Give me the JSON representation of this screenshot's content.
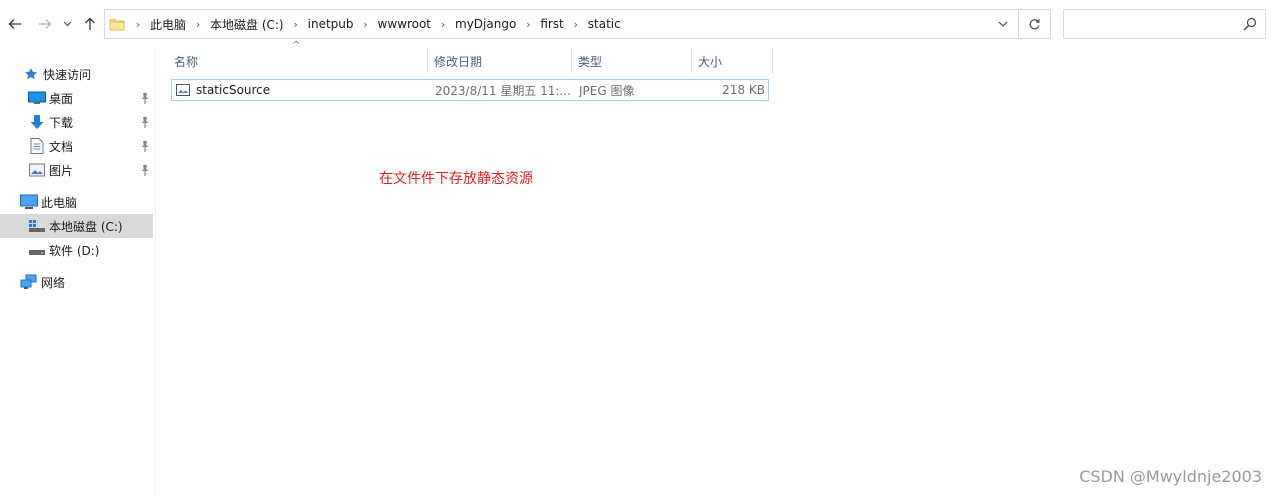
{
  "toolbar": {
    "back_icon": "arrow-left-icon",
    "forward_icon": "arrow-right-icon",
    "recent_icon": "chevron-down-icon",
    "up_icon": "arrow-up-icon"
  },
  "address": {
    "folder_icon": "folder-icon",
    "crumbs": [
      "此电脑",
      "本地磁盘 (C:)",
      "inetpub",
      "wwwroot",
      "myDjango",
      "first",
      "static"
    ],
    "dropdown_icon": "chevron-down-icon",
    "refresh_icon": "refresh-icon"
  },
  "search": {
    "placeholder": "",
    "value": "",
    "icon": "search-icon"
  },
  "navpane": {
    "quick_access": {
      "label": "快速访问",
      "icon": "star-icon"
    },
    "pinned": [
      {
        "label": "桌面",
        "icon": "desktop-icon",
        "pinned": true
      },
      {
        "label": "下载",
        "icon": "download-icon",
        "pinned": true
      },
      {
        "label": "文档",
        "icon": "document-icon",
        "pinned": true
      },
      {
        "label": "图片",
        "icon": "pictures-icon",
        "pinned": true
      }
    ],
    "this_pc": {
      "label": "此电脑",
      "icon": "computer-icon"
    },
    "drives": [
      {
        "label": "本地磁盘 (C:)",
        "icon": "drive-icon",
        "selected": true
      },
      {
        "label": "软件 (D:)",
        "icon": "drive-icon",
        "selected": false
      }
    ],
    "network": {
      "label": "网络",
      "icon": "network-icon"
    }
  },
  "filelist": {
    "columns": [
      "名称",
      "修改日期",
      "类型",
      "大小"
    ],
    "sort_indicator": "^",
    "rows": [
      {
        "name": "staticSource",
        "modified": "2023/8/11 星期五 11:...",
        "type": "JPEG 图像",
        "size": "218 KB",
        "icon": "image-file-icon"
      }
    ]
  },
  "annotation": "在文件件下存放静态资源",
  "watermark": "CSDN @Mwyldnje2003",
  "colors": {
    "annotation": "#e02020",
    "selection_border": "#99d1ff",
    "nav_selected": "#d9d9d9",
    "header_text": "#4c607a",
    "folder": "#f8d775"
  }
}
